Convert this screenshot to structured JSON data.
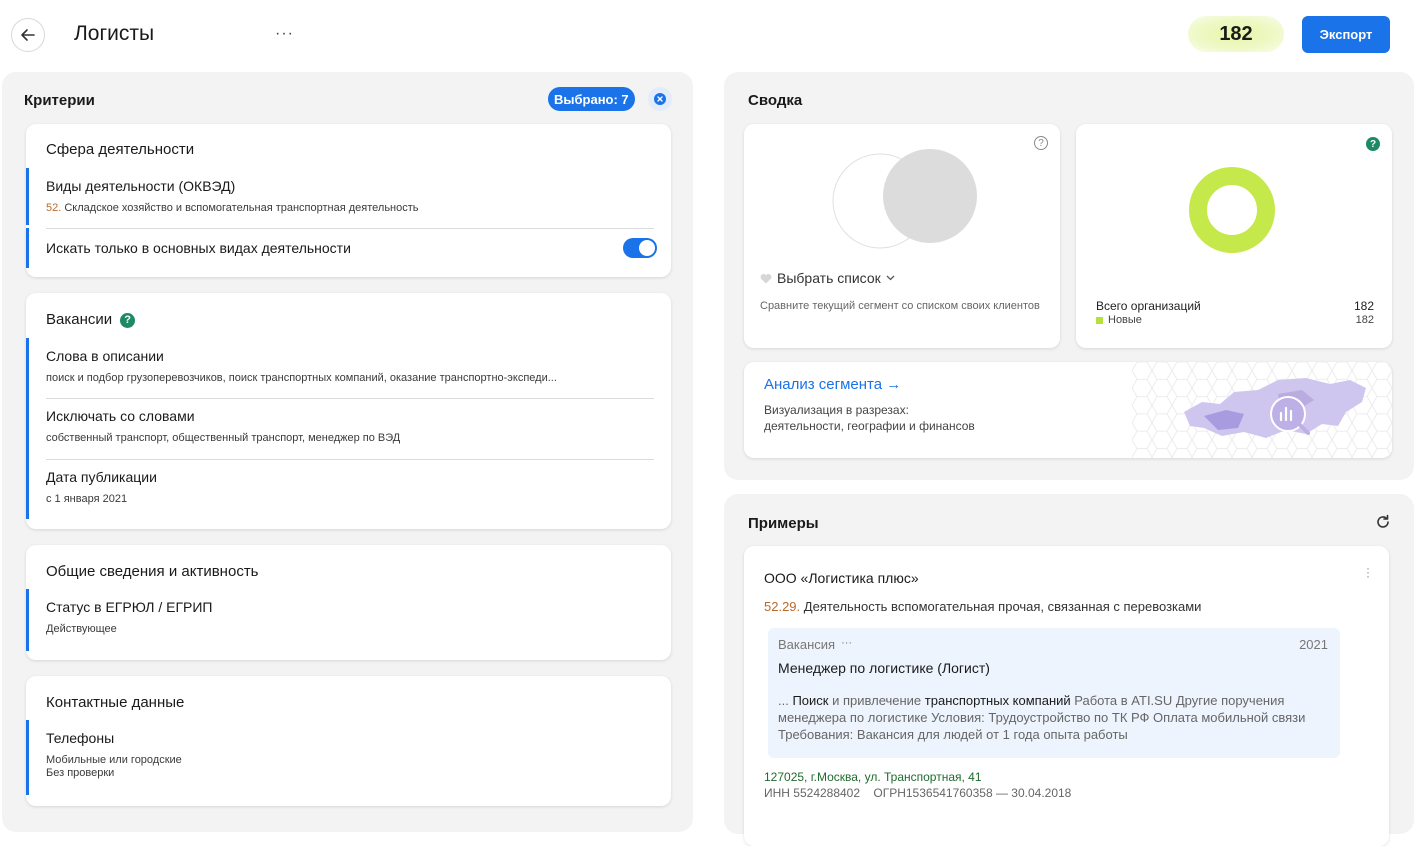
{
  "header": {
    "title": "Логисты",
    "more": "···",
    "count": "182",
    "export_label": "Экспорт"
  },
  "criteria": {
    "title": "Критерии",
    "selected_label": "Выбрано: 7",
    "activity": {
      "title": "Сфера деятельности",
      "okved_title": "Виды деятельности (ОКВЭД)",
      "okved_code": "52.",
      "okved_text": " Складское хозяйство и вспомогательная транспортная деятельность",
      "main_only_label": "Искать только в основных видах деятельности",
      "main_only_on": true
    },
    "vacancies": {
      "title": "Вакансии",
      "words_title": "Слова в описании",
      "words_value": "поиск и подбор грузоперевозчиков, поиск транспортных компаний, оказание транспортно-экспеди...",
      "exclude_title": "Исключать со словами",
      "exclude_value": "собственный транспорт, общественный транспорт, менеджер по ВЭД",
      "date_title": "Дата публикации",
      "date_value": "с 1 января 2021"
    },
    "general": {
      "title": "Общие сведения и активность",
      "status_title": "Статус в ЕГРЮЛ / ЕГРИП",
      "status_value": "Действующее"
    },
    "contacts": {
      "title": "Контактные данные",
      "phones_title": "Телефоны",
      "phones_line1": "Мобильные или городские",
      "phones_line2": "Без проверки"
    }
  },
  "summary": {
    "title": "Сводка",
    "compare": {
      "select_list_label": "Выбрать список",
      "description": "Сравните текущий сегмент со списком своих клиентов"
    },
    "totals": {
      "total_label": "Всего организаций",
      "total_value": "182",
      "new_label": "Новые",
      "new_value": "182"
    },
    "analysis": {
      "link": "Анализ сегмента →",
      "line1": "Визуализация в разрезах:",
      "line2": "деятельности, географии и финансов"
    },
    "colors": {
      "accent": "#1a73e8",
      "donut": "#c5e84a",
      "new_dot": "#b6e03b"
    }
  },
  "examples": {
    "title": "Примеры",
    "company_name": "ООО «Логистика плюс»",
    "okved_code": "52.29.",
    "okved_text": " Деятельность вспомогательная прочая, связанная с перевозками",
    "vacancy_label": "Вакансия",
    "vacancy_more": "···",
    "vacancy_year": "2021",
    "vacancy_title": "Менеджер по логистике (Логист)",
    "snippet": {
      "p1": "... ",
      "b1": "Поиск",
      "p2": " и привлечение ",
      "b2": "транспортных компаний",
      "p3": " Работа в ATI.SU Другие поручения менеджера по логистике Условия: Трудоустройство по ТК РФ Оплата мобильной связи Требования: Вакансия для людей от 1 года опыта работы"
    },
    "address": "127025, г.Москва,  ул. Транспортная, 41",
    "ids": "ИНН 5524288402    ОГРН1536541760358 — 30.04.2018"
  }
}
